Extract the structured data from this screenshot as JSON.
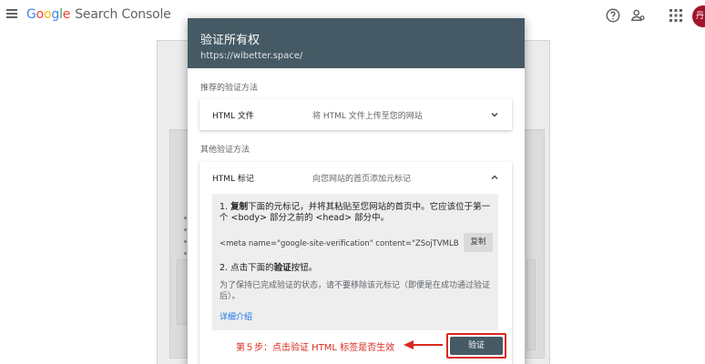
{
  "topbar": {
    "brand_letters": [
      "G",
      "o",
      "o",
      "g",
      "l",
      "e"
    ],
    "product": "Search Console",
    "avatar_initial": "丹",
    "icons": [
      "menu-icon",
      "help-icon",
      "users-icon",
      "apps-icon"
    ]
  },
  "dialog": {
    "title": "验证所有权",
    "url": "https://wibetter.space/",
    "recommended_label": "推荐的验证方法",
    "other_label": "其他验证方法",
    "methods": [
      {
        "name": "HTML 文件",
        "desc": "将 HTML 文件上传至您的网站",
        "expanded": false
      },
      {
        "name": "HTML 标记",
        "desc": "向您网站的首页添加元标记",
        "expanded": true
      }
    ],
    "instructions": {
      "step1_prefix": "1. ",
      "step1_bold": "复制",
      "step1_text": "下面的元标记，并将其粘贴至您网站的首页中。它应该位于第一个 <body> 部分之前的 <head> 部分中。",
      "meta_code": "<meta name=\"google-site-verification\" content=\"ZSojTVMLBYkA",
      "copy_label": "复制",
      "step2_prefix": "2. 点击下面的",
      "step2_bold": "验证",
      "step2_suffix": "按钮。",
      "note": "为了保持已完成验证的状态，请不要移除该元标记（即便是在成功通过验证后）。",
      "details_link": "详细介绍"
    },
    "verify_label": "验证",
    "annotation": "第５步：点击验证 HTML 标签是否生效"
  },
  "colors": {
    "header": "#455a64",
    "annotation": "#d9281f",
    "link": "#1a73e8",
    "avatar": "#a0152b"
  }
}
